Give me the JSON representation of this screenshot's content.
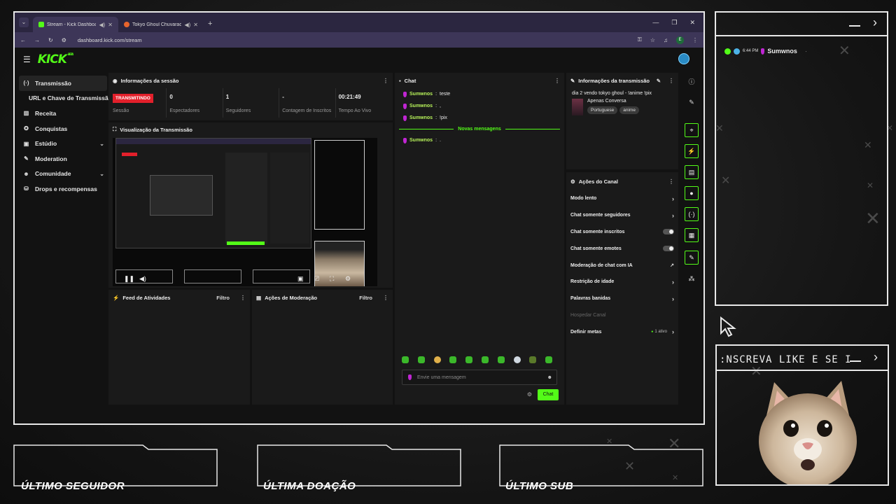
{
  "browser": {
    "tabs": [
      {
        "label": "Stream - Kick Dashboard",
        "fav_color": "#53fc18"
      },
      {
        "label": "Tokyo Ghoul Chuvarada - A",
        "fav_color": "#e8642c"
      }
    ],
    "url": "dashboard.kick.com/stream",
    "ext_label": "E"
  },
  "kick": {
    "logo": "KICK",
    "beta": "BETA"
  },
  "sidebar": {
    "items": [
      {
        "label": "Transmissão",
        "icon": "(·)"
      },
      {
        "label": "URL e Chave de Transmissão",
        "icon": ""
      },
      {
        "label": "Receita",
        "icon": "▥"
      },
      {
        "label": "Conquistas",
        "icon": "✪"
      },
      {
        "label": "Estúdio",
        "icon": "▣"
      },
      {
        "label": "Moderation",
        "icon": "✎"
      },
      {
        "label": "Comunidade",
        "icon": "☻"
      },
      {
        "label": "Drops e recompensas",
        "icon": "⛁"
      }
    ]
  },
  "session": {
    "title": "Informações da sessão",
    "live_badge": "TRANSMITINDO",
    "stats": [
      {
        "value": "",
        "label": "Sessão"
      },
      {
        "value": "0",
        "label": "Espectadores"
      },
      {
        "value": "1",
        "label": "Seguidores"
      },
      {
        "value": "-",
        "label": "Contagem de Inscritos"
      },
      {
        "value": "00:21:49",
        "label": "Tempo Ao Vivo"
      }
    ]
  },
  "preview": {
    "title": "Visualização da Transmissão"
  },
  "feed": {
    "title": "Feed de Atividades",
    "filter": "Filtro"
  },
  "modactions": {
    "title": "Ações de Moderação",
    "filter": "Filtro"
  },
  "chat": {
    "title": "Chat",
    "messages": [
      {
        "user": "Sumwnos",
        "text": "teste"
      },
      {
        "user": "Sumwnos",
        "text": ","
      },
      {
        "user": "Sumwnos",
        "text": "!pix"
      }
    ],
    "new_messages_label": "Novas mensagens",
    "after": [
      {
        "user": "Sumwnos",
        "text": "."
      }
    ],
    "placeholder": "Envie uma mensagem",
    "send_label": "Chat"
  },
  "stream_info": {
    "title": "Informações da transmissão",
    "stream_title": "dia 2 vendo tokyo ghoul - !anime !pix",
    "category": "Apenas Conversa",
    "tags": [
      "Portuguese",
      "anime"
    ]
  },
  "channel_actions": {
    "title": "Ações do Canal",
    "items": [
      {
        "label": "Modo lento",
        "control": "chevron"
      },
      {
        "label": "Chat somente seguidores",
        "control": "chevron"
      },
      {
        "label": "Chat somente inscritos",
        "control": "toggle"
      },
      {
        "label": "Chat somente emotes",
        "control": "toggle"
      },
      {
        "label": "Moderação de chat com IA",
        "control": "external"
      },
      {
        "label": "Restrição de idade",
        "control": "chevron"
      },
      {
        "label": "Palavras banidas",
        "control": "chevron"
      },
      {
        "label": "Hospedar Canal",
        "control": "none"
      },
      {
        "label": "Definir metas",
        "control": "chevron",
        "status": "1 ativo"
      }
    ]
  },
  "overlay": {
    "chat_time": "6:44 PM",
    "chat_user": "Sumwnos",
    "chat_text": ".",
    "cam_title": ":NSCREVA LIKE E SE I",
    "labels": [
      "ÚLTIMO SEGUIDOR",
      "ÚLTIMA DOAÇÃO",
      "ÚLTIMO SUB"
    ]
  },
  "colors": {
    "accent": "#53fc18",
    "live": "#e3202b",
    "tab_bar": "#2b2640"
  }
}
